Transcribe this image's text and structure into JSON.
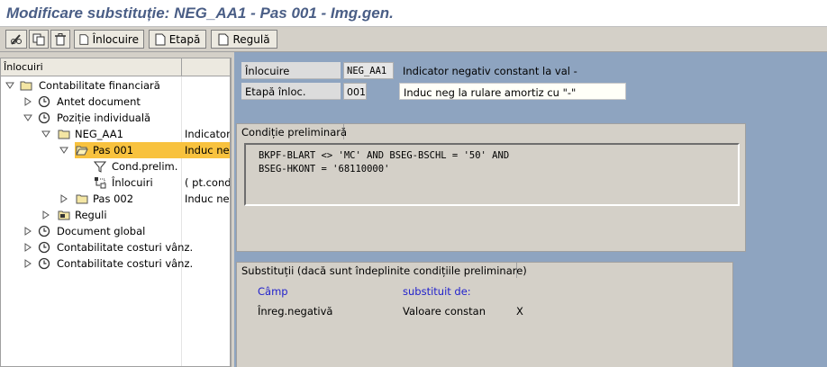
{
  "title": "Modificare substituție: NEG_AA1 - Pas 001 - Img.gen.",
  "toolbar": {
    "edit_icon": "pencil-glasses-icon",
    "copy_icon": "copy-icon",
    "delete_icon": "trash-icon",
    "btn_inlocuire": "Înlocuire",
    "btn_etapa": "Etapă",
    "btn_regula": "Regulă"
  },
  "tree": {
    "header": "Înlocuiri",
    "rows": [
      {
        "label": "Contabilitate financiară",
        "col2": ""
      },
      {
        "label": "Antet document",
        "col2": ""
      },
      {
        "label": "Poziție individuală",
        "col2": ""
      },
      {
        "label": "NEG_AA1",
        "col2": "Indicator"
      },
      {
        "label": "Pas 001",
        "col2": "Induc neg"
      },
      {
        "label": "Cond.prelim.",
        "col2": ""
      },
      {
        "label": "Înlocuiri",
        "col2": "( pt.condit"
      },
      {
        "label": "Pas 002",
        "col2": "Induc neg"
      },
      {
        "label": "Reguli",
        "col2": ""
      },
      {
        "label": "Document global",
        "col2": ""
      },
      {
        "label": "Contabilitate costuri vânz.",
        "col2": ""
      },
      {
        "label": "Contabilitate costuri vânz.",
        "col2": ""
      }
    ]
  },
  "header_fields": {
    "inlocuire_label": "Înlocuire",
    "inlocuire_value": "NEG_AA1",
    "inlocuire_desc": "Indicator negativ constant la val -",
    "etapa_label": "Etapă înloc.",
    "etapa_value": "001",
    "etapa_desc": "Induc neg la rulare amortiz cu \"-\""
  },
  "conditie": {
    "tab": "Condiție preliminară",
    "line1": "BKPF-BLART <> 'MC' AND BSEG-BSCHL = '50' AND",
    "line2": "BSEG-HKONT = '68110000'"
  },
  "substitutii": {
    "tab": "Substituții (dacă sunt îndeplinite condițiile preliminare)",
    "col_camp": "Câmp",
    "col_subst": "substituit de:",
    "row_field": "Înreg.negativă",
    "row_value": "Valoare constan",
    "row_flag": "X"
  },
  "colors": {
    "title": "#4a5e86",
    "selected": "#f8c23e",
    "right_bg": "#8ea4c0",
    "col_header": "#2222cc"
  }
}
